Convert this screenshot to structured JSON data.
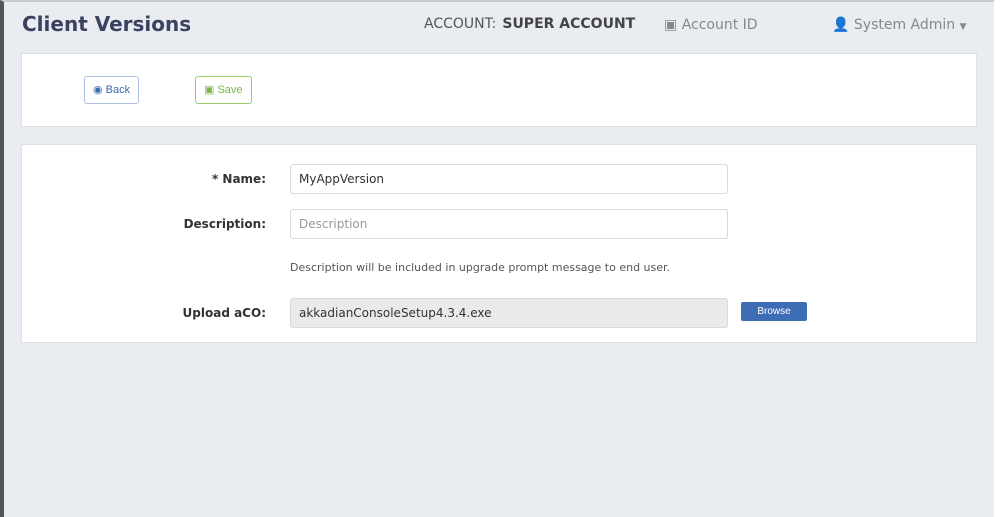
{
  "header": {
    "title": "Client Versions",
    "account_label": "ACCOUNT:",
    "account_name": "SUPER ACCOUNT",
    "account_id": "Account ID",
    "user": "System Admin"
  },
  "toolbar": {
    "back": "Back",
    "save": "Save"
  },
  "form": {
    "name_label": "* Name:",
    "name_value": "MyAppVersion",
    "description_label": "Description:",
    "description_placeholder": "Description",
    "description_help": "Description will be included in upgrade prompt message to end user.",
    "upload_label": "Upload aCO:",
    "upload_value": "akkadianConsoleSetup4.3.4.exe",
    "browse": "Browse"
  }
}
